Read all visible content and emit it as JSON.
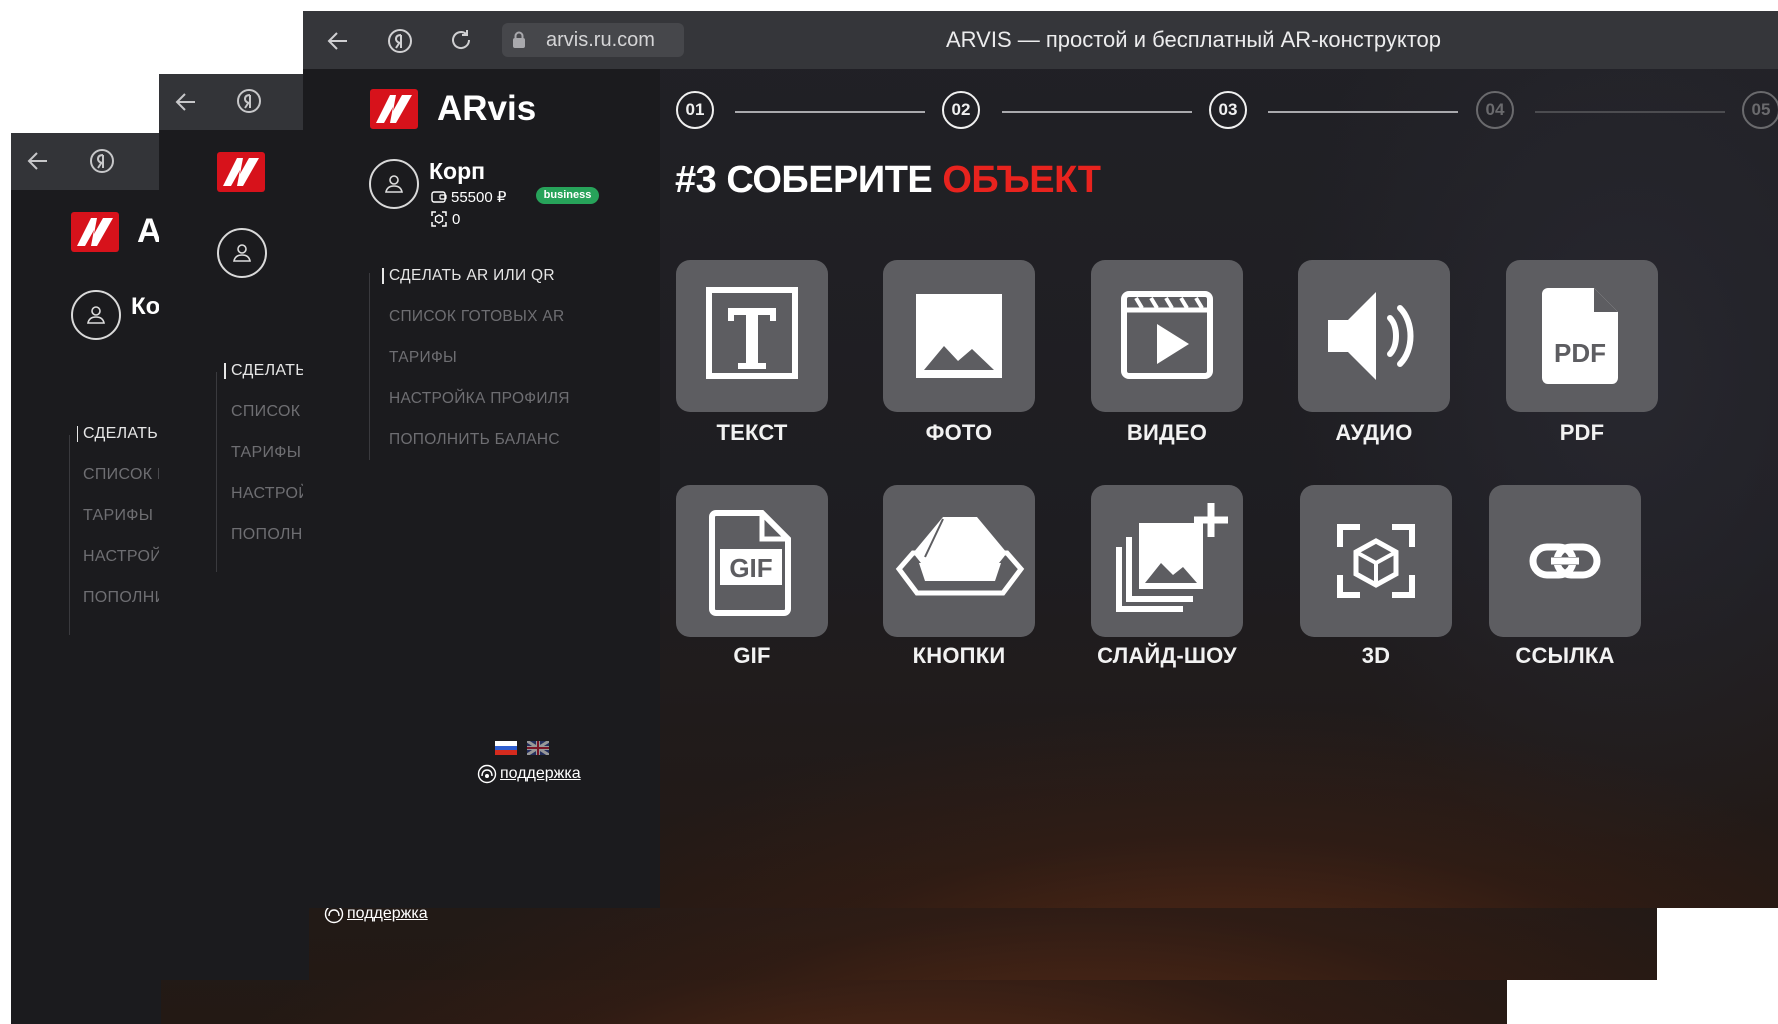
{
  "browser": {
    "url": "arvis.ru.com",
    "page_title": "ARVIS — простой и бесплатный AR-конструктор"
  },
  "app": {
    "logo_text": "ARvis",
    "user": {
      "name": "Корп",
      "balance": "55500 ₽",
      "plan_badge": "business",
      "ar_count": "0"
    },
    "menu": [
      {
        "label": "СДЕЛАТЬ AR ИЛИ QR",
        "active": true
      },
      {
        "label": "СПИСОК ГОТОВЫХ AR",
        "active": false
      },
      {
        "label": "ТАРИФЫ",
        "active": false
      },
      {
        "label": "НАСТРОЙКА ПРОФИЛЯ",
        "active": false
      },
      {
        "label": "ПОПОЛНИТЬ БАЛАНС",
        "active": false
      }
    ],
    "support_label": "поддержка",
    "languages": [
      "ru",
      "en"
    ]
  },
  "steps": [
    "01",
    "02",
    "03",
    "04",
    "05"
  ],
  "current_step": 3,
  "heading": {
    "prefix": "#3 СОБЕРИТЕ",
    "accent": "ОБЪЕКТ"
  },
  "objects": [
    {
      "label": "ТЕКСТ",
      "icon": "text-icon"
    },
    {
      "label": "ФОТО",
      "icon": "photo-icon"
    },
    {
      "label": "ВИДЕО",
      "icon": "video-icon"
    },
    {
      "label": "АУДИО",
      "icon": "audio-icon"
    },
    {
      "label": "PDF",
      "icon": "pdf-icon"
    },
    {
      "label": "GIF",
      "icon": "gif-icon"
    },
    {
      "label": "КНОПКИ",
      "icon": "button-icon"
    },
    {
      "label": "СЛАЙД-ШОУ",
      "icon": "slideshow-icon"
    },
    {
      "label": "3D",
      "icon": "cube-3d-icon"
    },
    {
      "label": "ССЫЛКА",
      "icon": "link-icon"
    }
  ],
  "icon_glyphs": {
    "pdf": "PDF",
    "gif": "GIF"
  },
  "colors": {
    "accent": "#e8231e",
    "tile": "#5d5d61",
    "badge": "#27a35a",
    "logo": "#d7121b"
  }
}
